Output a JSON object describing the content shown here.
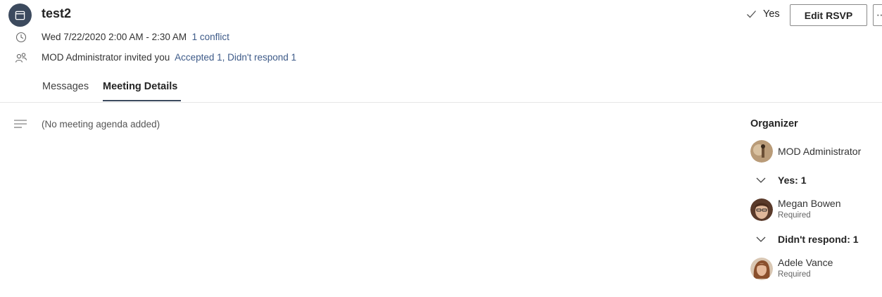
{
  "header": {
    "title": "test2",
    "datetime": "Wed 7/22/2020 2:00 AM - 2:30 AM",
    "conflict_link": "1 conflict",
    "invited_text": "MOD Administrator invited you",
    "responses_link": "Accepted 1, Didn't respond 1",
    "rsvp_status": "Yes",
    "edit_rsvp_label": "Edit RSVP",
    "more_label": "⋯"
  },
  "tabs": [
    {
      "label": "Messages",
      "active": false
    },
    {
      "label": "Meeting Details",
      "active": true
    }
  ],
  "agenda": {
    "text": "(No meeting agenda added)"
  },
  "attendees": {
    "organizer_heading": "Organizer",
    "organizer": {
      "name": "MOD Administrator"
    },
    "groups": [
      {
        "label": "Yes: 1",
        "people": [
          {
            "name": "Megan Bowen",
            "role": "Required"
          }
        ]
      },
      {
        "label": "Didn't respond: 1",
        "people": [
          {
            "name": "Adele Vance",
            "role": "Required"
          }
        ]
      }
    ]
  },
  "colors": {
    "accent": "#3c4a5e",
    "link": "#3d5a88"
  },
  "icons": [
    "calendar-icon",
    "clock-icon",
    "people-icon",
    "checkmark-icon",
    "agenda-lines-icon",
    "chevron-down-icon"
  ]
}
